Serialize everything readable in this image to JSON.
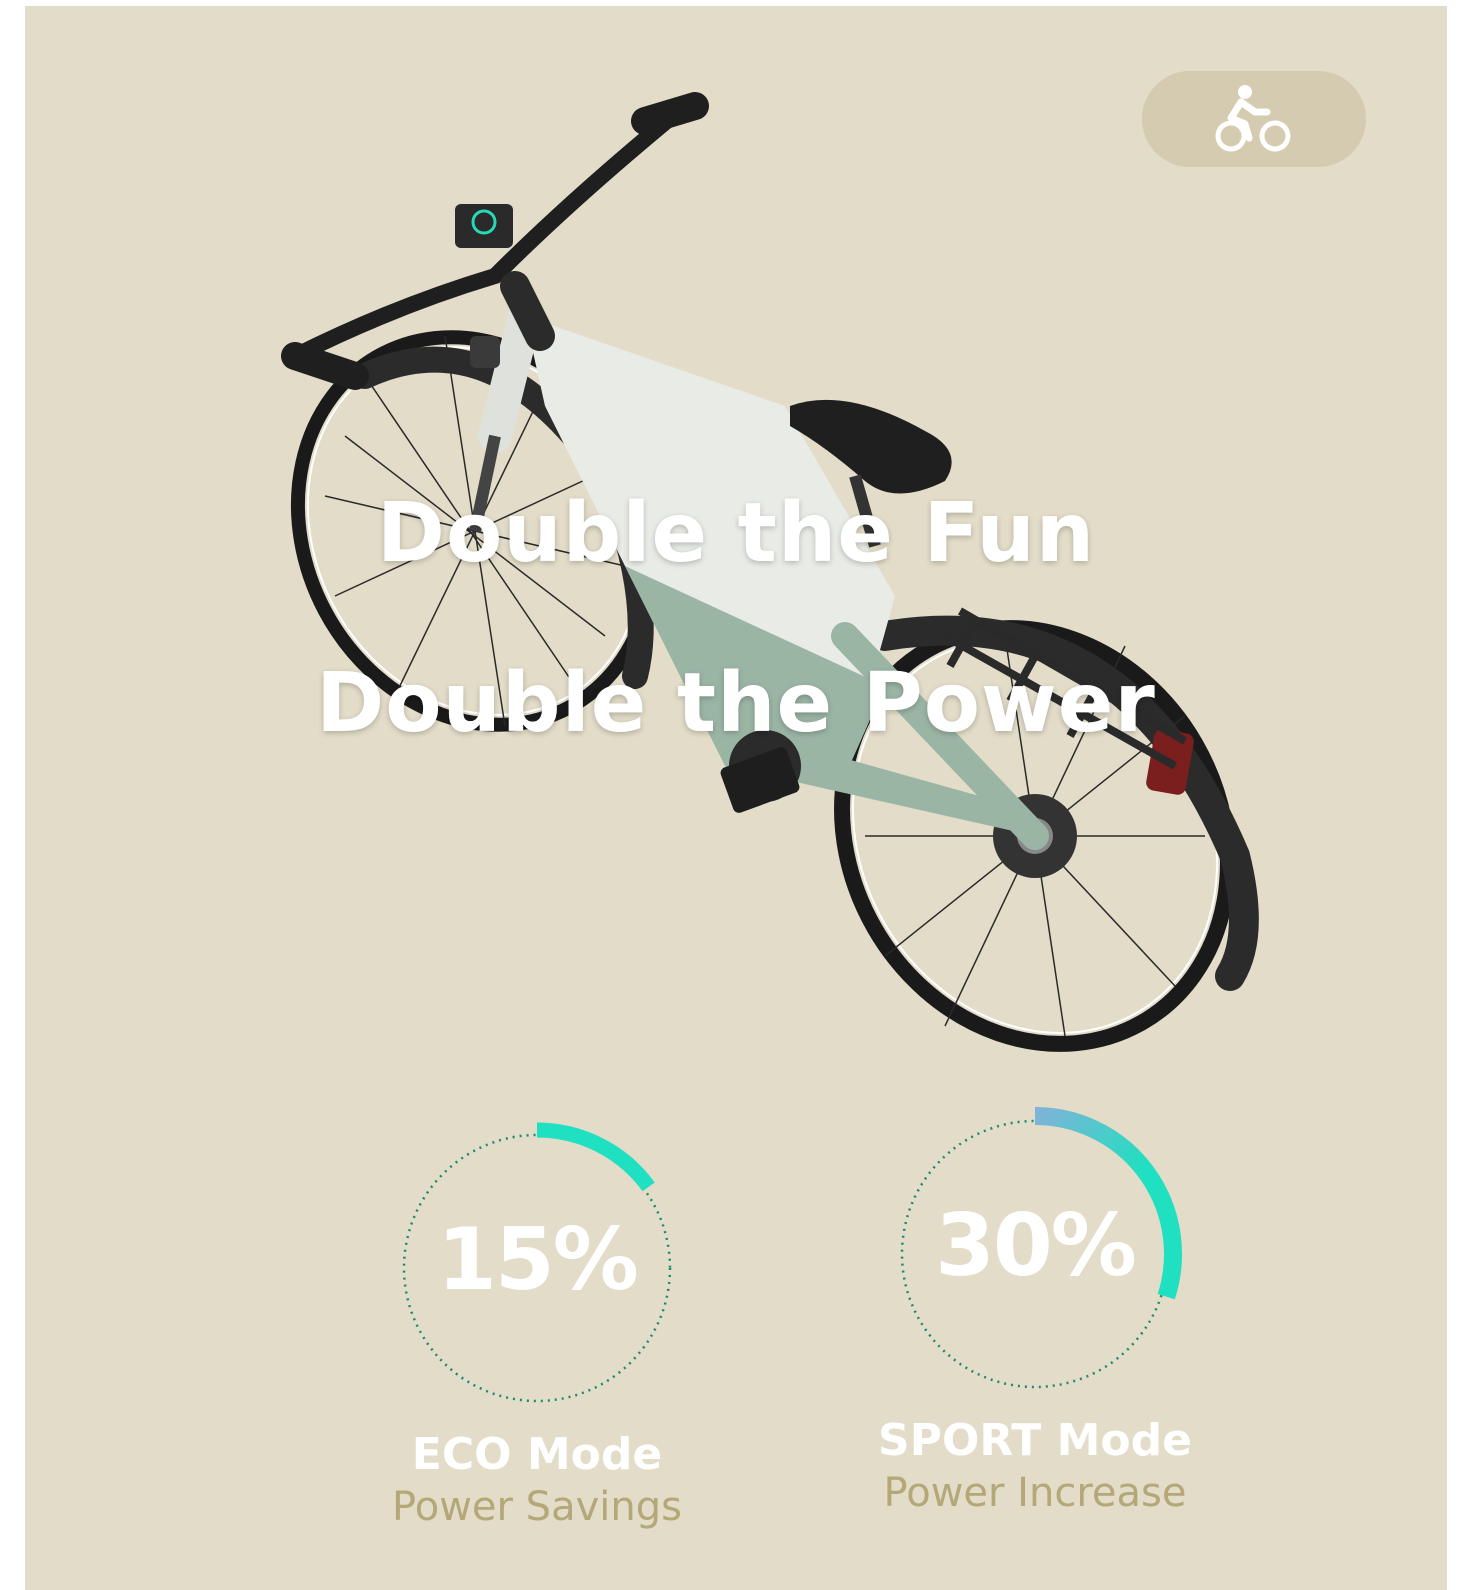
{
  "mode_button": {
    "icon": "cyclist-icon"
  },
  "hero": {
    "line1": "Double the Fun",
    "line2": "Double the Power"
  },
  "stats": [
    {
      "percent": 15,
      "percent_label": "15%",
      "title": "ECO Mode",
      "subtitle": "Power Savings"
    },
    {
      "percent": 30,
      "percent_label": "30%",
      "title": "SPORT Mode",
      "subtitle": "Power Increase"
    }
  ],
  "colors": {
    "background": "#e2dcc8",
    "pill": "#d4cbb0",
    "accent": "#1fe0c0",
    "dotted_ring": "#1c8a6e",
    "subtitle": "#b4a878"
  }
}
